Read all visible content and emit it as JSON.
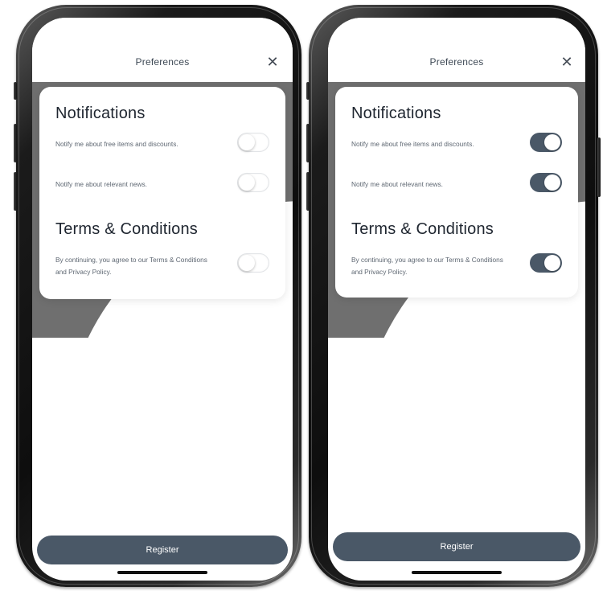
{
  "screens": [
    {
      "header": {
        "title": "Preferences",
        "close_symbol": "✕"
      },
      "notifications": {
        "heading": "Notifications",
        "items": [
          {
            "label": "Notify me about free items and discounts.",
            "enabled": false
          },
          {
            "label": "Notify me about relevant news.",
            "enabled": false
          }
        ]
      },
      "terms": {
        "heading": "Terms & Conditions",
        "label": "By continuing, you agree to our Terms & Conditions and Privacy Policy.",
        "enabled": false
      },
      "register_label": "Register"
    },
    {
      "header": {
        "title": "Preferences",
        "close_symbol": "✕"
      },
      "notifications": {
        "heading": "Notifications",
        "items": [
          {
            "label": "Notify me about free items and discounts.",
            "enabled": true
          },
          {
            "label": "Notify me about relevant news.",
            "enabled": true
          }
        ]
      },
      "terms": {
        "heading": "Terms & Conditions",
        "label": "By continuing, you agree to our Terms & Conditions and Privacy Policy.",
        "enabled": true
      },
      "register_label": "Register"
    }
  ],
  "colors": {
    "accent": "#4a5867",
    "backdrop": "#6f6f6f",
    "heading_text": "#1f2630",
    "body_text": "#5e6772"
  }
}
